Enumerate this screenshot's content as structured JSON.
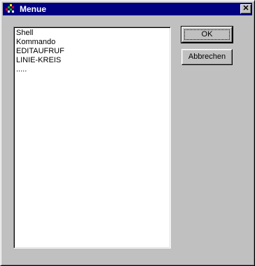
{
  "window": {
    "title": "Menue",
    "close_glyph": "✕"
  },
  "list": {
    "items": [
      "Shell",
      "Kommando",
      "EDITAUFRUF",
      "LINIE-KREIS",
      "....."
    ]
  },
  "buttons": {
    "ok_label": "OK",
    "cancel_label": "Abbrechen"
  },
  "colors": {
    "titlebar": "#000080",
    "face": "#c0c0c0",
    "list_bg": "#ffffff"
  },
  "icons": {
    "app": "app-icon",
    "close": "close-icon"
  }
}
